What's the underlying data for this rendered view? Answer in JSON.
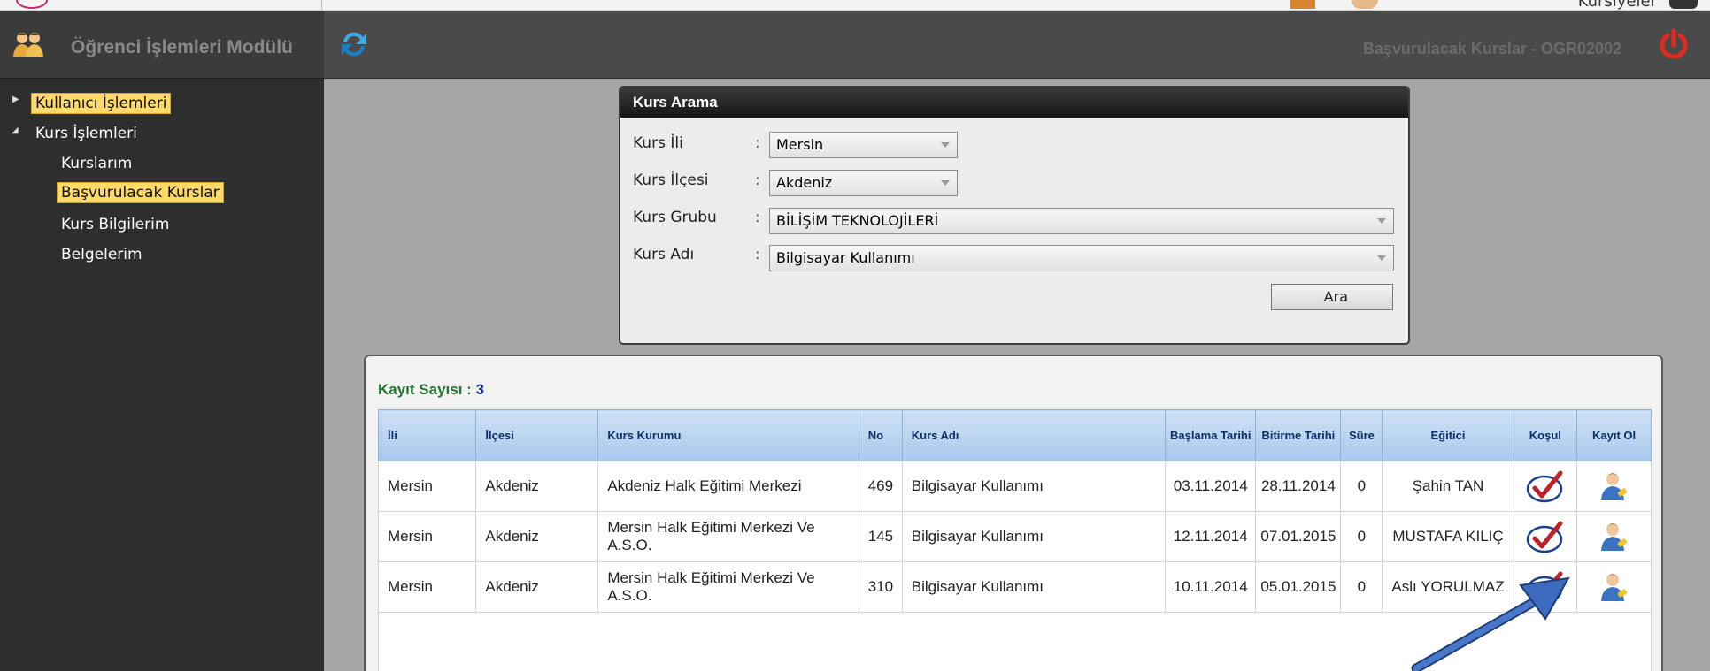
{
  "topbar": {
    "user_label": "Kursiyeler"
  },
  "sidebar": {
    "module_title": "Öğrenci İşlemleri Modülü",
    "tree": {
      "group1": "Kullanıcı İşlemleri",
      "group2": "Kurs İşlemleri",
      "items": [
        "Kurslarım",
        "Başvurulacak Kurslar",
        "Kurs Bilgilerim",
        "Belgelerim"
      ]
    }
  },
  "header": {
    "page_code": "Başvurulacak Kurslar - OGR02002"
  },
  "search": {
    "title": "Kurs Arama",
    "fields": [
      {
        "label": "Kurs İli",
        "value": "Mersin"
      },
      {
        "label": "Kurs İlçesi",
        "value": "Akdeniz"
      },
      {
        "label": "Kurs Grubu",
        "value": "BİLİŞİM TEKNOLOJİLERİ"
      },
      {
        "label": "Kurs Adı",
        "value": "Bilgisayar Kullanımı"
      }
    ],
    "colon": ":",
    "button_label": "Ara"
  },
  "results": {
    "count_label": "Kayıt Sayısı :",
    "count_value": "3",
    "columns": [
      "İli",
      "İlçesi",
      "Kurs Kurumu",
      "No",
      "Kurs Adı",
      "Başlama Tarihi",
      "Bitirme Tarihi",
      "Süre",
      "Eğitici",
      "Koşul",
      "Kayıt Ol"
    ],
    "rows": [
      {
        "il": "Mersin",
        "ilce": "Akdeniz",
        "kurum": "Akdeniz Halk Eğitimi Merkezi",
        "no": "469",
        "kurs": "Bilgisayar Kullanımı",
        "baslama": "03.11.2014",
        "bitirme": "28.11.2014",
        "sure": "0",
        "egitici": "Şahin TAN"
      },
      {
        "il": "Mersin",
        "ilce": "Akdeniz",
        "kurum": "Mersin Halk Eğitimi Merkezi Ve A.S.O.",
        "no": "145",
        "kurs": "Bilgisayar Kullanımı",
        "baslama": "12.11.2014",
        "bitirme": "07.01.2015",
        "sure": "0",
        "egitici": "MUSTAFA KILIÇ"
      },
      {
        "il": "Mersin",
        "ilce": "Akdeniz",
        "kurum": "Mersin Halk Eğitimi Merkezi Ve A.S.O.",
        "no": "310",
        "kurs": "Bilgisayar Kullanımı",
        "baslama": "10.11.2014",
        "bitirme": "05.01.2015",
        "sure": "0",
        "egitici": "Aslı YORULMAZ"
      }
    ]
  },
  "icons": {
    "kosul": "check-condition-icon",
    "kayit": "register-person-icon"
  },
  "colors": {
    "accent_yellow": "#fdd96a",
    "header_dark": "#4a4a4a",
    "grid_header": "#a9c9ec",
    "count_green": "#21732f",
    "annotation_arrow": "#2f5aa8"
  }
}
